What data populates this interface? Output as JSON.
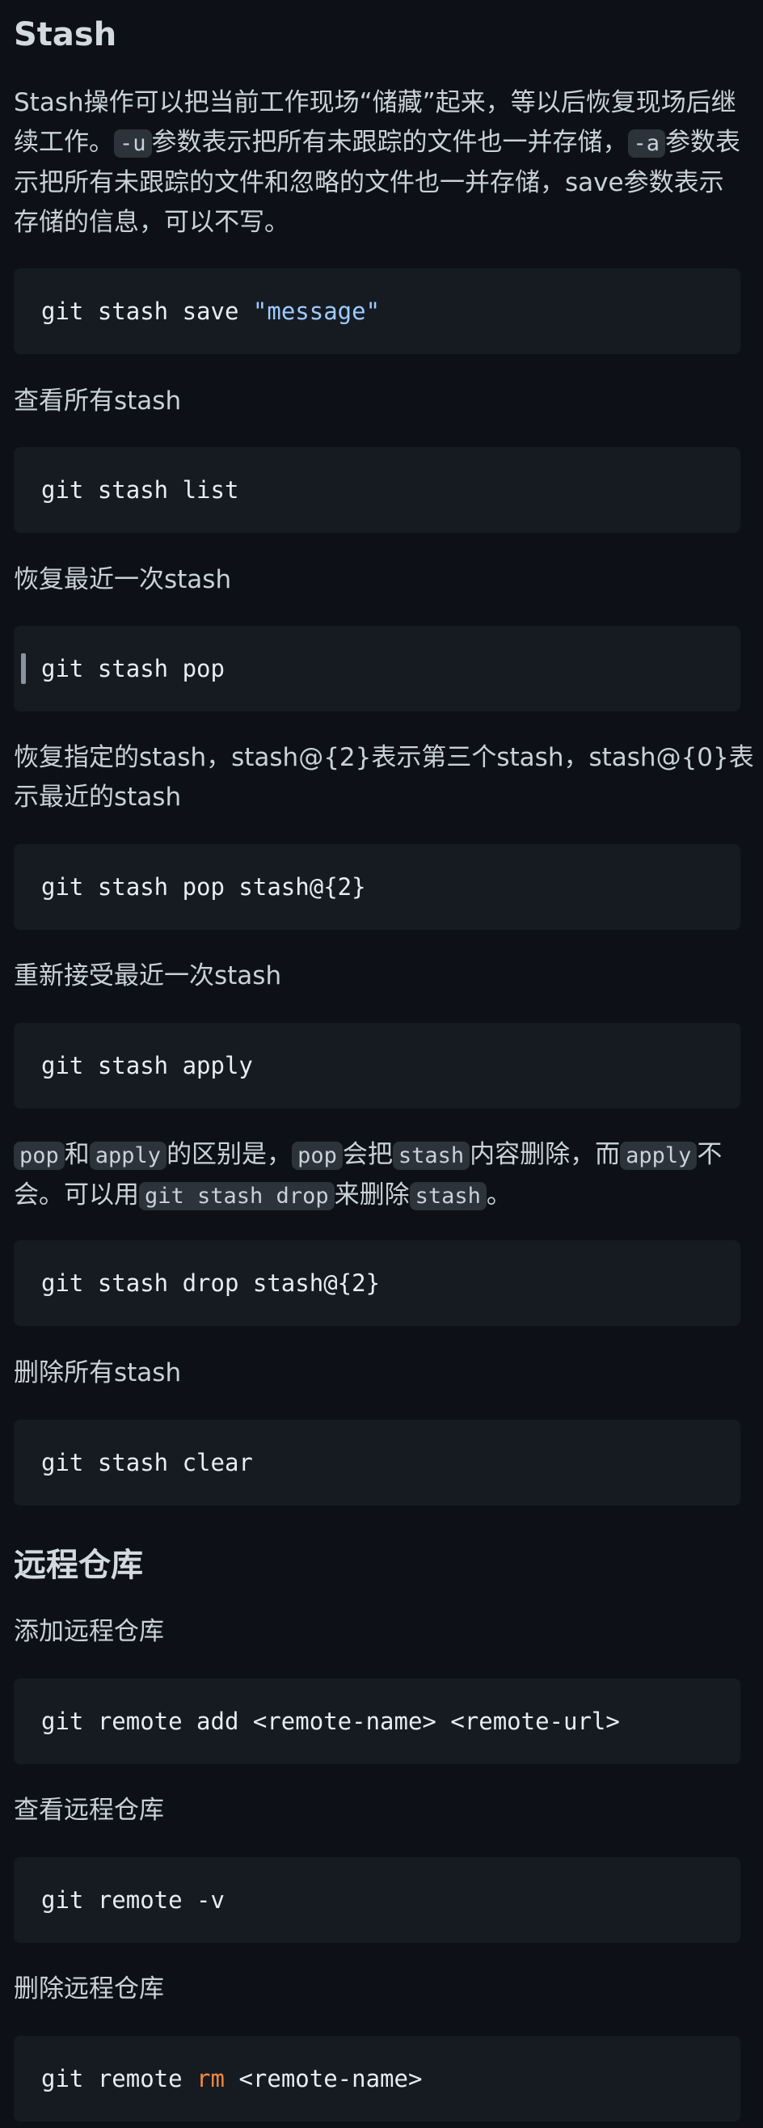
{
  "stash": {
    "heading": "Stash",
    "intro": {
      "t1": "Stash操作可以把当前工作现场“储藏”起来，等以后恢复现场后继续工作。",
      "c1": "-u",
      "t2": "参数表示把所有未跟踪的文件也一并存储，",
      "c2": "-a",
      "t3": "参数表示把所有未跟踪的文件和忽略的文件也一并存储，save参数表示存储的信息，可以不写。"
    },
    "save_cmd": "git stash save ",
    "save_msg": "\"message\"",
    "list_label": "查看所有stash",
    "list_cmd": "git stash list",
    "pop_label": "恢复最近一次stash",
    "pop_cmd": "git stash pop",
    "pop_n_label": "恢复指定的stash，stash@{2}表示第三个stash，stash@{0}表示最近的stash",
    "pop_n_cmd": "git stash pop stash@{2}",
    "apply_label": "重新接受最近一次stash",
    "apply_cmd": "git stash apply",
    "diff": {
      "c1": "pop",
      "t1": "和",
      "c2": "apply",
      "t2": "的区别是，",
      "c3": "pop",
      "t3": "会把",
      "c4": "stash",
      "t4": "内容删除，而",
      "c5": "apply",
      "t5": "不会。可以用",
      "c6": "git stash drop",
      "t6": "来删除",
      "c7": "stash",
      "t7": "。"
    },
    "drop_cmd": "git stash drop stash@{2}",
    "clear_label": "删除所有stash",
    "clear_cmd": "git stash clear"
  },
  "remote": {
    "heading": "远程仓库",
    "add_label": "添加远程仓库",
    "add_cmd": "git remote add <remote-name> <remote-url>",
    "view_label": "查看远程仓库",
    "view_cmd": "git remote -v",
    "rm_label": "删除远程仓库",
    "rm_cmd_a": "git remote ",
    "rm_cmd_kw": "rm",
    "rm_cmd_b": " <remote-name>"
  },
  "colors": {
    "background": "#0d1117",
    "code_block": "#161b22",
    "inline_code": "#2d333b",
    "string": "#9ecbff",
    "keyword": "#f0883e"
  }
}
